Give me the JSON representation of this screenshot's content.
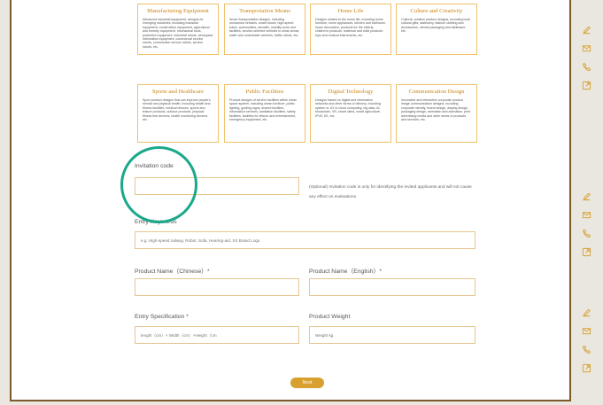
{
  "categories": [
    {
      "title": "Manufacturing Equipment",
      "desc": "Advanced industrial equipment, designs for emerging industries, including industrial equipment, construction equipment, agricultural and forestry equipment, mechanical tools, protective equipment, industrial robots, aerospace information equipment, commercial service robots, construction service robots, service robots, etc."
    },
    {
      "title": "Transportation Means",
      "desc": "Smart transportation designs, including unmanned vehicles, smart buses, high-speed trains, automobiles, aircrafts, mobility tools and facilities, service-oriented vehicles in urban areas, water and underwater vehicles, traffic robots, etc."
    },
    {
      "title": "Home Life",
      "desc": "Designs related to the home life, including home furniture, home appliances, kitchen and bathroom, home decoration, products for the elderly, children's products, maternal and child products, toys and musical instruments, etc."
    },
    {
      "title": "Culture and Creativity",
      "desc": "Cultural, creative product designs, including local cultural gifts, stationery, fashion clothing and accessories, utensil packaging and tableware, etc."
    },
    {
      "title": "Sports and Healthcare",
      "desc": "Sport product designs that can improve people's mental and physical health, including health and fitness facilities, medical devices, sports and leisure products, outdoor products, physical fitness test devices, health monitoring devices, etc."
    },
    {
      "title": "Public Facilities",
      "desc": "Product designs of service facilities within urban space system, including urban furniture, public lighting, guiding signs, shared facilities, information services, sanitation facilities, safety facilities, facilities for leisure and entertainment, emergency equipment, etc."
    },
    {
      "title": "Digital Technology",
      "desc": "Designs based on digital and information networks and other forms of delivery, including system or UX in cloud computing, big data, AI, blockchain, VR, smart cities, smart agriculture, IPV6, 5G, etc."
    },
    {
      "title": "Communication Design",
      "desc": "Innovative and interactive corporate product image communication designs, including corporate identity, brand design, display design, packaging design, animation and animation, print advertising media and other areas of products and services, etc."
    }
  ],
  "form": {
    "invitation_label": "Invitation code",
    "invitation_value": "",
    "invitation_note": "(Optional) Invitation code is only for identifying the invited applicants and will not cause any effect on evaluations.",
    "entry_keywords_label": "Entry Keywords",
    "entry_keywords_placeholder": "e.g. High-speed railway, Robot, Sofa, Hearing-aid, XX Brand Logo",
    "product_name_cn_label": "Product Name（Chinese）*",
    "product_name_en_label": "Product Name（English）*",
    "entry_spec_label": "Entry Specification *",
    "entry_spec_placeholder": "length（cm）× Width（cm）×Height（cm",
    "product_weight_label": "Product Weight",
    "product_weight_placeholder": "Weight kg",
    "next_label": "Next"
  },
  "sidebar_groups": [
    [
      "edit-icon",
      "mail-icon",
      "phone-icon",
      "external-link-icon"
    ],
    [
      "edit-icon",
      "mail-icon",
      "phone-icon",
      "external-link-icon"
    ],
    [
      "edit-icon",
      "mail-icon",
      "phone-icon",
      "external-link-icon"
    ]
  ],
  "colors": {
    "accent": "#d8a02f",
    "card_title": "#c98414",
    "border": "#e7c68f",
    "frame": "#7d5a2b",
    "highlight_circle": "#19a88a"
  }
}
